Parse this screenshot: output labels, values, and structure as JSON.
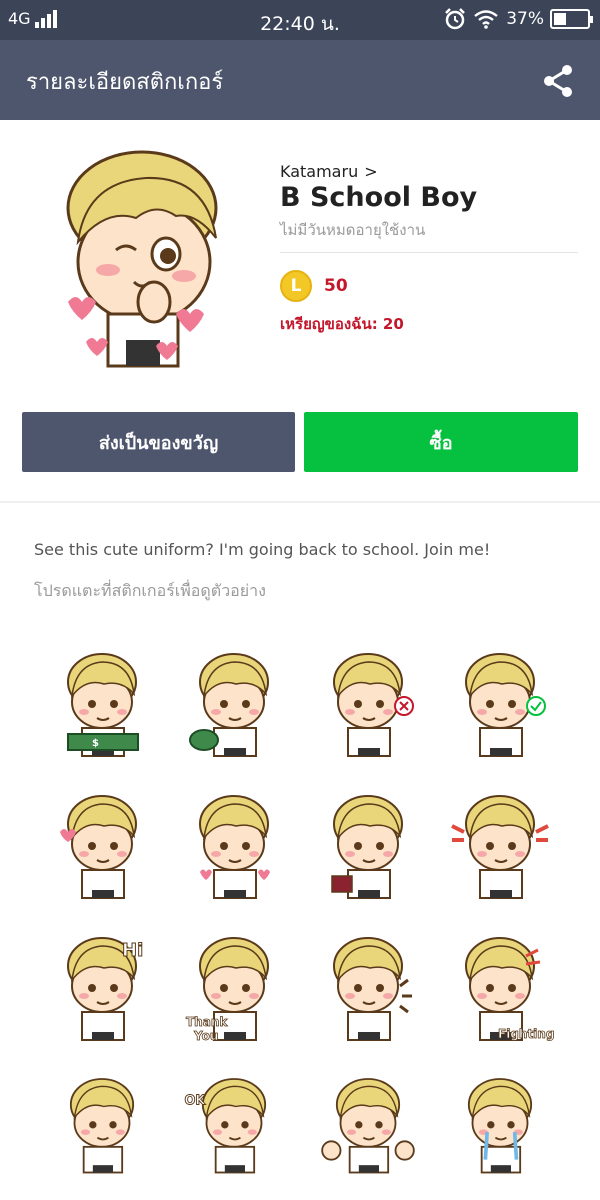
{
  "status_bar": {
    "network": "4G",
    "time": "22:40 น.",
    "battery_percent": "37%",
    "battery_level": 0.37
  },
  "header": {
    "title": "รายละเอียดสติกเกอร์",
    "share_icon": "share-icon"
  },
  "product": {
    "creator": "Katamaru",
    "creator_chevron": ">",
    "title": "B School Boy",
    "validity": "ไม่มีวันหมดอายุใช้งาน",
    "coin_label": "L",
    "price": "50",
    "my_coins": "เหรียญของฉัน: 20"
  },
  "actions": {
    "gift_label": "ส่งเป็นของขวัญ",
    "buy_label": "ซื้อ"
  },
  "colors": {
    "header_bg": "#4e566d",
    "status_bg": "#3c4458",
    "buy_green": "#06c13f",
    "price_red": "#c4172b",
    "coin_gold": "#f3c826"
  },
  "description": "See this cute uniform? I'm going back to school. Join me!",
  "hint": "โปรดแตะที่สติกเกอร์เพื่อดูตัวอย่าง",
  "stickers": {
    "texts": {
      "hi": "Hi",
      "thank": "Thank",
      "you": "You",
      "fighting": "Fighting",
      "ok": "OK"
    }
  }
}
